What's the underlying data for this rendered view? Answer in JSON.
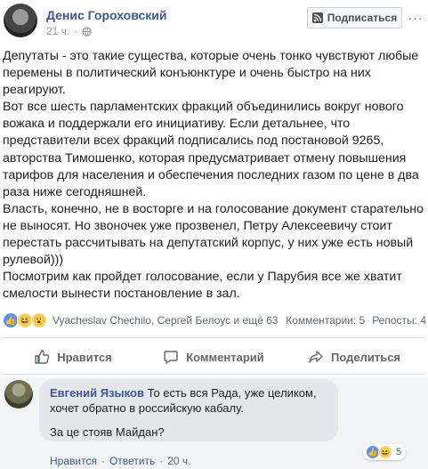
{
  "post": {
    "author": "Денис Гороховский",
    "time": "21 ч.",
    "subscribe_label": "Подписаться",
    "more_label": "···",
    "paragraphs": [
      "Депутаты - это такие существа, которые очень тонко чувствуют любые перемены в политический конъюнктуре и очень быстро на них реагируют.",
      "Вот все шесть парламентских фракций объединились вокруг нового вожака и поддержали его инициативу. Если детальнее, что представители всех фракций подписались под постановой 9265, авторства Тимошенко, которая предусматривает отмену повышения тарифов для населения и обеспечения последних газом по цене в два раза ниже сегодняшней.",
      "Власть, конечно, не в восторге и на голосование документ старательно не выносят. Но звоночек уже прозвенел, Петру Алексеевичу стоит перестать рассчитывать на депутатский корпус, у них уже есть новый рулевой)))",
      "Посмотрим как пройдет голосование, если у Парубия все же хватит смелости вынести постановление в зал."
    ]
  },
  "reactions": {
    "reactors_text": "Vyacheslav Chechilo, Сергей Белоус и ещё 63",
    "comments_text": "Комментарии: 5",
    "shares_text": "Репосты: 4"
  },
  "actions": {
    "like_label": "Нравится",
    "comment_label": "Комментарий",
    "share_label": "Поделиться"
  },
  "comment": {
    "author": "Евгений Языков",
    "text": "То есть вся Рада, уже целиком, хочет обратно в российскую кабалу.",
    "reply_text": "За це стояв Майдан?",
    "reaction_count": "5",
    "like_label": "Нравится",
    "reply_label": "Ответить",
    "time": "20 ч.",
    "separator": "·"
  },
  "icons": {
    "avatar": "avatar",
    "globe": "globe-icon",
    "rss": "rss-icon",
    "like": "like-icon",
    "comment": "comment-icon",
    "share": "share-icon"
  },
  "colors": {
    "link": "#385898",
    "muted": "#606770",
    "like_blue": "#5890ff"
  }
}
